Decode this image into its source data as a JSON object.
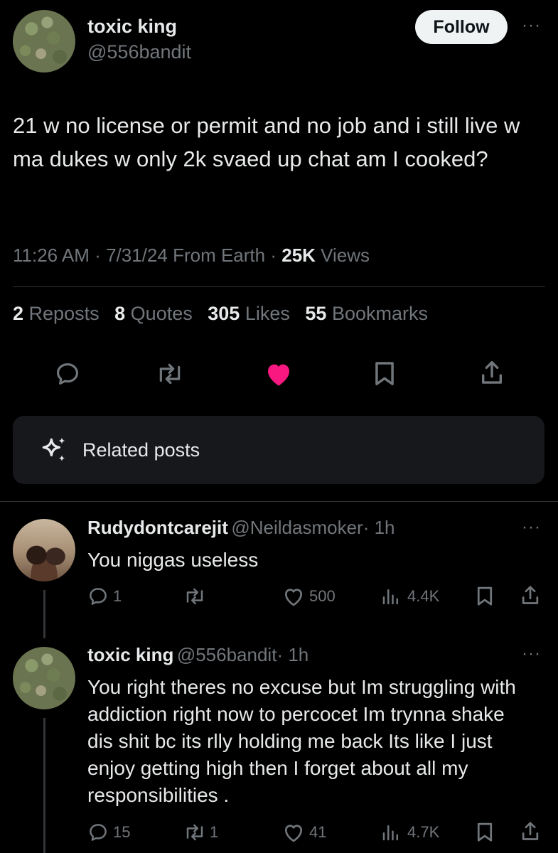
{
  "post": {
    "author_name": "toxic king",
    "author_handle": "@556bandit",
    "follow_label": "Follow",
    "more_label": "···",
    "text": "21 w no license or permit and no job and i still live w ma dukes w only 2k svaed up chat am I cooked?",
    "time": "11:26 AM",
    "date": "7/31/24",
    "source": "From Earth",
    "views_count": "25K",
    "views_label": "Views",
    "sep": "·",
    "stats": {
      "reposts_count": "2",
      "reposts_label": "Reposts",
      "quotes_count": "8",
      "quotes_label": "Quotes",
      "likes_count": "305",
      "likes_label": "Likes",
      "bookmarks_count": "55",
      "bookmarks_label": "Bookmarks"
    },
    "liked": true,
    "accent_like": "#f91880"
  },
  "related": {
    "label": "Related posts",
    "icon": "sparkle-icon"
  },
  "replies": [
    {
      "name": "Rudydontcarejit",
      "handle": "@Neildasmoker",
      "age": "· 1h",
      "text": "You niggas useless",
      "replies": "1",
      "reposts": "",
      "likes": "500",
      "views": "4.4K"
    },
    {
      "name": "toxic king",
      "handle": "@556bandit",
      "age": "· 1h",
      "text": "You right theres no excuse but Im struggling with addiction right now to percocet Im trynna shake dis shit bc its rlly holding me back Its like I just enjoy getting high then I forget about all my responsibilities .",
      "replies": "15",
      "reposts": "1",
      "likes": "41",
      "views": "4.7K"
    }
  ],
  "colors": {
    "background": "#000000",
    "muted": "#71767b",
    "text": "#e7e9ea",
    "divider": "#2f3336"
  }
}
